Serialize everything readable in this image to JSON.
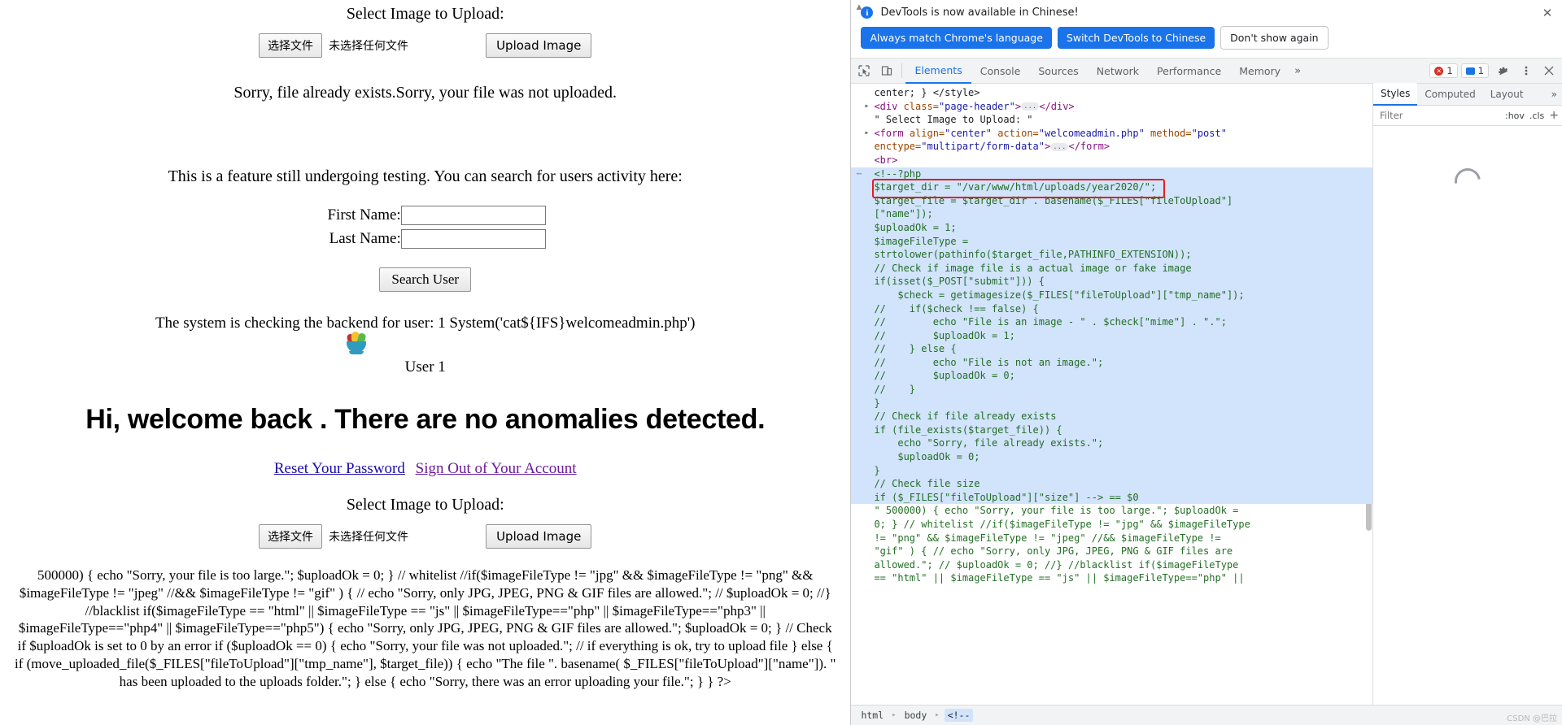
{
  "page": {
    "upload_title_top": "Select Image to Upload:",
    "file_choose_label": "选择文件",
    "file_none_label": "未选择任何文件",
    "upload_button": "Upload Image",
    "error_message": "Sorry, file already exists.Sorry, your file was not uploaded.",
    "feature_text": "This is a feature still undergoing testing. You can search for users activity here:",
    "first_name_label": "First Name:",
    "last_name_label": "Last Name:",
    "first_name_value": "",
    "last_name_value": "",
    "search_button": "Search User",
    "system_line": "The system is checking the backend for user: 1 System('cat${IFS}welcomeadmin.php')",
    "user_line": "User 1",
    "welcome_heading": "Hi, welcome back . There are no anomalies detected.",
    "link_reset": "Reset Your Password",
    "link_signout": "Sign Out of Your Account",
    "upload_title_bottom": "Select Image to Upload:",
    "php_dump": "500000) { echo \"Sorry, your file is too large.\"; $uploadOk = 0; } // whitelist //if($imageFileType != \"jpg\" && $imageFileType != \"png\" && $imageFileType != \"jpeg\" //&& $imageFileType != \"gif\" ) { // echo \"Sorry, only JPG, JPEG, PNG & GIF files are allowed.\"; // $uploadOk = 0; //} //blacklist if($imageFileType == \"html\" || $imageFileType == \"js\" || $imageFileType==\"php\" || $imageFileType==\"php3\" || $imageFileType==\"php4\" || $imageFileType==\"php5\") { echo \"Sorry, only JPG, JPEG, PNG & GIF files are allowed.\"; $uploadOk = 0; } // Check if $uploadOk is set to 0 by an error if ($uploadOk == 0) { echo \"Sorry, your file was not uploaded.\"; // if everything is ok, try to upload file } else { if (move_uploaded_file($_FILES[\"fileToUpload\"][\"tmp_name\"], $target_file)) { echo \"The file \". basename( $_FILES[\"fileToUpload\"][\"name\"]). \" has been uploaded to the uploads folder.\"; } else { echo \"Sorry, there was an error uploading your file.\"; } } ?>",
    "link_color_unvisited": "#1a0dab",
    "link_color_visited": "#6a1b9a",
    "salad_icon": "salad-bowl-emoji"
  },
  "devtools": {
    "notice": {
      "icon": "info-icon",
      "text": "DevTools is now available in Chinese!",
      "btn_always": "Always match Chrome's language",
      "btn_switch": "Switch DevTools to Chinese",
      "btn_dismiss": "Don't show again",
      "close_icon": "close-icon",
      "primary_color": "#1a73e8"
    },
    "toolbar": {
      "inspect_icon": "inspect-element-icon",
      "device_icon": "device-toolbar-icon",
      "tabs": [
        {
          "label": "Elements",
          "active": true
        },
        {
          "label": "Console",
          "active": false
        },
        {
          "label": "Sources",
          "active": false
        },
        {
          "label": "Network",
          "active": false
        },
        {
          "label": "Performance",
          "active": false
        },
        {
          "label": "Memory",
          "active": false
        }
      ],
      "more_tabs_icon": "chevron-double-right-icon",
      "error_count": "1",
      "message_count": "1",
      "settings_icon": "gear-icon",
      "menu_icon": "kebab-menu-icon",
      "close_icon": "close-icon"
    },
    "dom_lines": [
      {
        "indent": 0,
        "parts": [
          {
            "c": "tx",
            "t": "center; } </style>"
          }
        ]
      },
      {
        "indent": 0,
        "triangle": true,
        "parts": [
          {
            "c": "tg",
            "t": "<div "
          },
          {
            "c": "at",
            "t": "class="
          },
          {
            "c": "av",
            "t": "\"page-header\""
          },
          {
            "c": "tg",
            "t": ">"
          },
          {
            "c": "ell",
            "t": "..."
          },
          {
            "c": "tg",
            "t": "</div>"
          }
        ]
      },
      {
        "indent": 0,
        "parts": [
          {
            "c": "tx",
            "t": "\" Select Image to Upload: \""
          }
        ]
      },
      {
        "indent": 0,
        "triangle": true,
        "parts": [
          {
            "c": "tg",
            "t": "<form "
          },
          {
            "c": "at",
            "t": "align="
          },
          {
            "c": "av",
            "t": "\"center\""
          },
          {
            "c": "at",
            "t": " action="
          },
          {
            "c": "av",
            "t": "\"welcomeadmin.php\""
          },
          {
            "c": "at",
            "t": " method="
          },
          {
            "c": "av",
            "t": "\"post\""
          }
        ]
      },
      {
        "indent": 0,
        "parts": [
          {
            "c": "at",
            "t": "enctype="
          },
          {
            "c": "av",
            "t": "\"multipart/form-data\""
          },
          {
            "c": "tg",
            "t": ">"
          },
          {
            "c": "ell",
            "t": "..."
          },
          {
            "c": "tg",
            "t": "</form>"
          }
        ]
      },
      {
        "indent": 0,
        "parts": [
          {
            "c": "tg",
            "t": "<br>"
          }
        ]
      },
      {
        "indent": 0,
        "hl": true,
        "dots": true,
        "parts": [
          {
            "c": "cm",
            "t": "<!--?php"
          }
        ]
      },
      {
        "indent": 0,
        "hl": true,
        "redbox": true,
        "parts": [
          {
            "c": "cm",
            "t": "$target_dir = \"/var/www/html/uploads/year2020/\";"
          }
        ]
      },
      {
        "indent": 0,
        "hl": true,
        "parts": [
          {
            "c": "cm",
            "t": "$target_file = $target_dir . basename($_FILES[\"fileToUpload\"]"
          }
        ]
      },
      {
        "indent": 0,
        "hl": true,
        "parts": [
          {
            "c": "cm",
            "t": "[\"name\"]);"
          }
        ]
      },
      {
        "indent": 0,
        "hl": true,
        "parts": [
          {
            "c": "cm",
            "t": "$uploadOk = 1;"
          }
        ]
      },
      {
        "indent": 0,
        "hl": true,
        "parts": [
          {
            "c": "cm",
            "t": "$imageFileType ="
          }
        ]
      },
      {
        "indent": 0,
        "hl": true,
        "parts": [
          {
            "c": "cm",
            "t": "strtolower(pathinfo($target_file,PATHINFO_EXTENSION));"
          }
        ]
      },
      {
        "indent": 0,
        "hl": true,
        "parts": [
          {
            "c": "cm",
            "t": "// Check if image file is a actual image or fake image"
          }
        ]
      },
      {
        "indent": 0,
        "hl": true,
        "parts": [
          {
            "c": "cm",
            "t": "if(isset($_POST[\"submit\"])) {"
          }
        ]
      },
      {
        "indent": 0,
        "hl": true,
        "parts": [
          {
            "c": "cm",
            "t": "    $check = getimagesize($_FILES[\"fileToUpload\"][\"tmp_name\"]);"
          }
        ]
      },
      {
        "indent": 0,
        "hl": true,
        "parts": [
          {
            "c": "cm",
            "t": "//    if($check !== false) {"
          }
        ]
      },
      {
        "indent": 0,
        "hl": true,
        "parts": [
          {
            "c": "cm",
            "t": "//        echo \"File is an image - \" . $check[\"mime\"] . \".\";"
          }
        ]
      },
      {
        "indent": 0,
        "hl": true,
        "parts": [
          {
            "c": "cm",
            "t": "//        $uploadOk = 1;"
          }
        ]
      },
      {
        "indent": 0,
        "hl": true,
        "parts": [
          {
            "c": "cm",
            "t": "//    } else {"
          }
        ]
      },
      {
        "indent": 0,
        "hl": true,
        "parts": [
          {
            "c": "cm",
            "t": "//        echo \"File is not an image.\";"
          }
        ]
      },
      {
        "indent": 0,
        "hl": true,
        "parts": [
          {
            "c": "cm",
            "t": "//        $uploadOk = 0;"
          }
        ]
      },
      {
        "indent": 0,
        "hl": true,
        "parts": [
          {
            "c": "cm",
            "t": "//    }"
          }
        ]
      },
      {
        "indent": 0,
        "hl": true,
        "parts": [
          {
            "c": "cm",
            "t": "}"
          }
        ]
      },
      {
        "indent": 0,
        "hl": true,
        "parts": [
          {
            "c": "cm",
            "t": "// Check if file already exists"
          }
        ]
      },
      {
        "indent": 0,
        "hl": true,
        "parts": [
          {
            "c": "cm",
            "t": "if (file_exists($target_file)) {"
          }
        ]
      },
      {
        "indent": 0,
        "hl": true,
        "parts": [
          {
            "c": "cm",
            "t": "    echo \"Sorry, file already exists.\";"
          }
        ]
      },
      {
        "indent": 0,
        "hl": true,
        "parts": [
          {
            "c": "cm",
            "t": "    $uploadOk = 0;"
          }
        ]
      },
      {
        "indent": 0,
        "hl": true,
        "parts": [
          {
            "c": "cm",
            "t": "}"
          }
        ]
      },
      {
        "indent": 0,
        "hl": true,
        "parts": [
          {
            "c": "cm",
            "t": "// Check file size"
          }
        ]
      },
      {
        "indent": 0,
        "hl": true,
        "parts": [
          {
            "c": "cm",
            "t": "if ($_FILES[\"fileToUpload\"][\"size\"] --> == $0"
          }
        ]
      },
      {
        "indent": 0,
        "parts": [
          {
            "c": "cm",
            "t": "\" 500000) { echo \"Sorry, your file is too large.\"; $uploadOk ="
          }
        ]
      },
      {
        "indent": 0,
        "parts": [
          {
            "c": "cm",
            "t": "0; } // whitelist //if($imageFileType != \"jpg\" && $imageFileType"
          }
        ]
      },
      {
        "indent": 0,
        "parts": [
          {
            "c": "cm",
            "t": "!= \"png\" && $imageFileType != \"jpeg\" //&& $imageFileType !="
          }
        ]
      },
      {
        "indent": 0,
        "parts": [
          {
            "c": "cm",
            "t": "\"gif\" ) { // echo \"Sorry, only JPG, JPEG, PNG & GIF files are"
          }
        ]
      },
      {
        "indent": 0,
        "parts": [
          {
            "c": "cm",
            "t": "allowed.\"; // $uploadOk = 0; //} //blacklist if($imageFileType"
          }
        ]
      },
      {
        "indent": 0,
        "parts": [
          {
            "c": "cm",
            "t": "== \"html\" || $imageFileType == \"js\" || $imageFileType==\"php\" ||"
          }
        ]
      }
    ],
    "styles": {
      "tabs": [
        {
          "label": "Styles",
          "active": true
        },
        {
          "label": "Computed",
          "active": false
        },
        {
          "label": "Layout",
          "active": false
        }
      ],
      "more_icon": "chevron-double-right-icon",
      "filter_placeholder": "Filter",
      "hov_label": ":hov",
      "cls_label": ".cls",
      "plus_label": "+",
      "loading_icon": "spinner-icon"
    },
    "breadcrumbs": [
      {
        "label": "html",
        "selected": false
      },
      {
        "label": "body",
        "selected": false
      },
      {
        "label": "<!--",
        "selected": true
      }
    ],
    "watermark": "CSDN @巴拉"
  }
}
